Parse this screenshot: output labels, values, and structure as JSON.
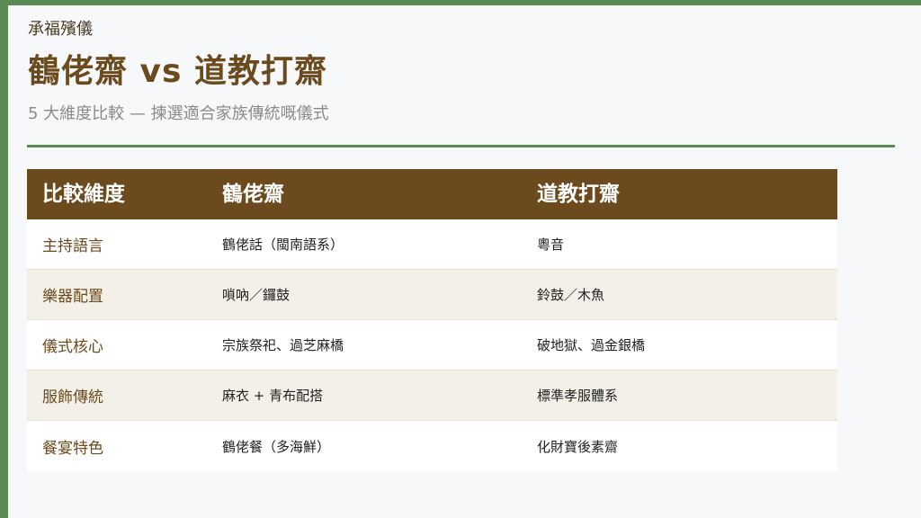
{
  "brand": "承福殯儀",
  "title": "鶴佬齋 vs 道教打齋",
  "subtitle": "5 大維度比較 — 揀選適合家族傳統嘅儀式",
  "table": {
    "headers": [
      "比較維度",
      "鶴佬齋",
      "道教打齋"
    ],
    "rows": [
      [
        "主持語言",
        "鶴佬話（閩南語系）",
        "粵音"
      ],
      [
        "樂器配置",
        "嗩吶／鑼鼓",
        "鈴鼓／木魚"
      ],
      [
        "儀式核心",
        "宗族祭祀、過芝麻橋",
        "破地獄、過金銀橋"
      ],
      [
        "服飾傳統",
        "麻衣 + 青布配搭",
        "標準孝服體系"
      ],
      [
        "餐宴特色",
        "鶴佬餐（多海鮮）",
        "化財寶後素齋"
      ]
    ]
  },
  "colors": {
    "accent_green": "#5c8a55",
    "header_brown": "#6b4a1e",
    "row_alt": "#f3f0e8"
  }
}
